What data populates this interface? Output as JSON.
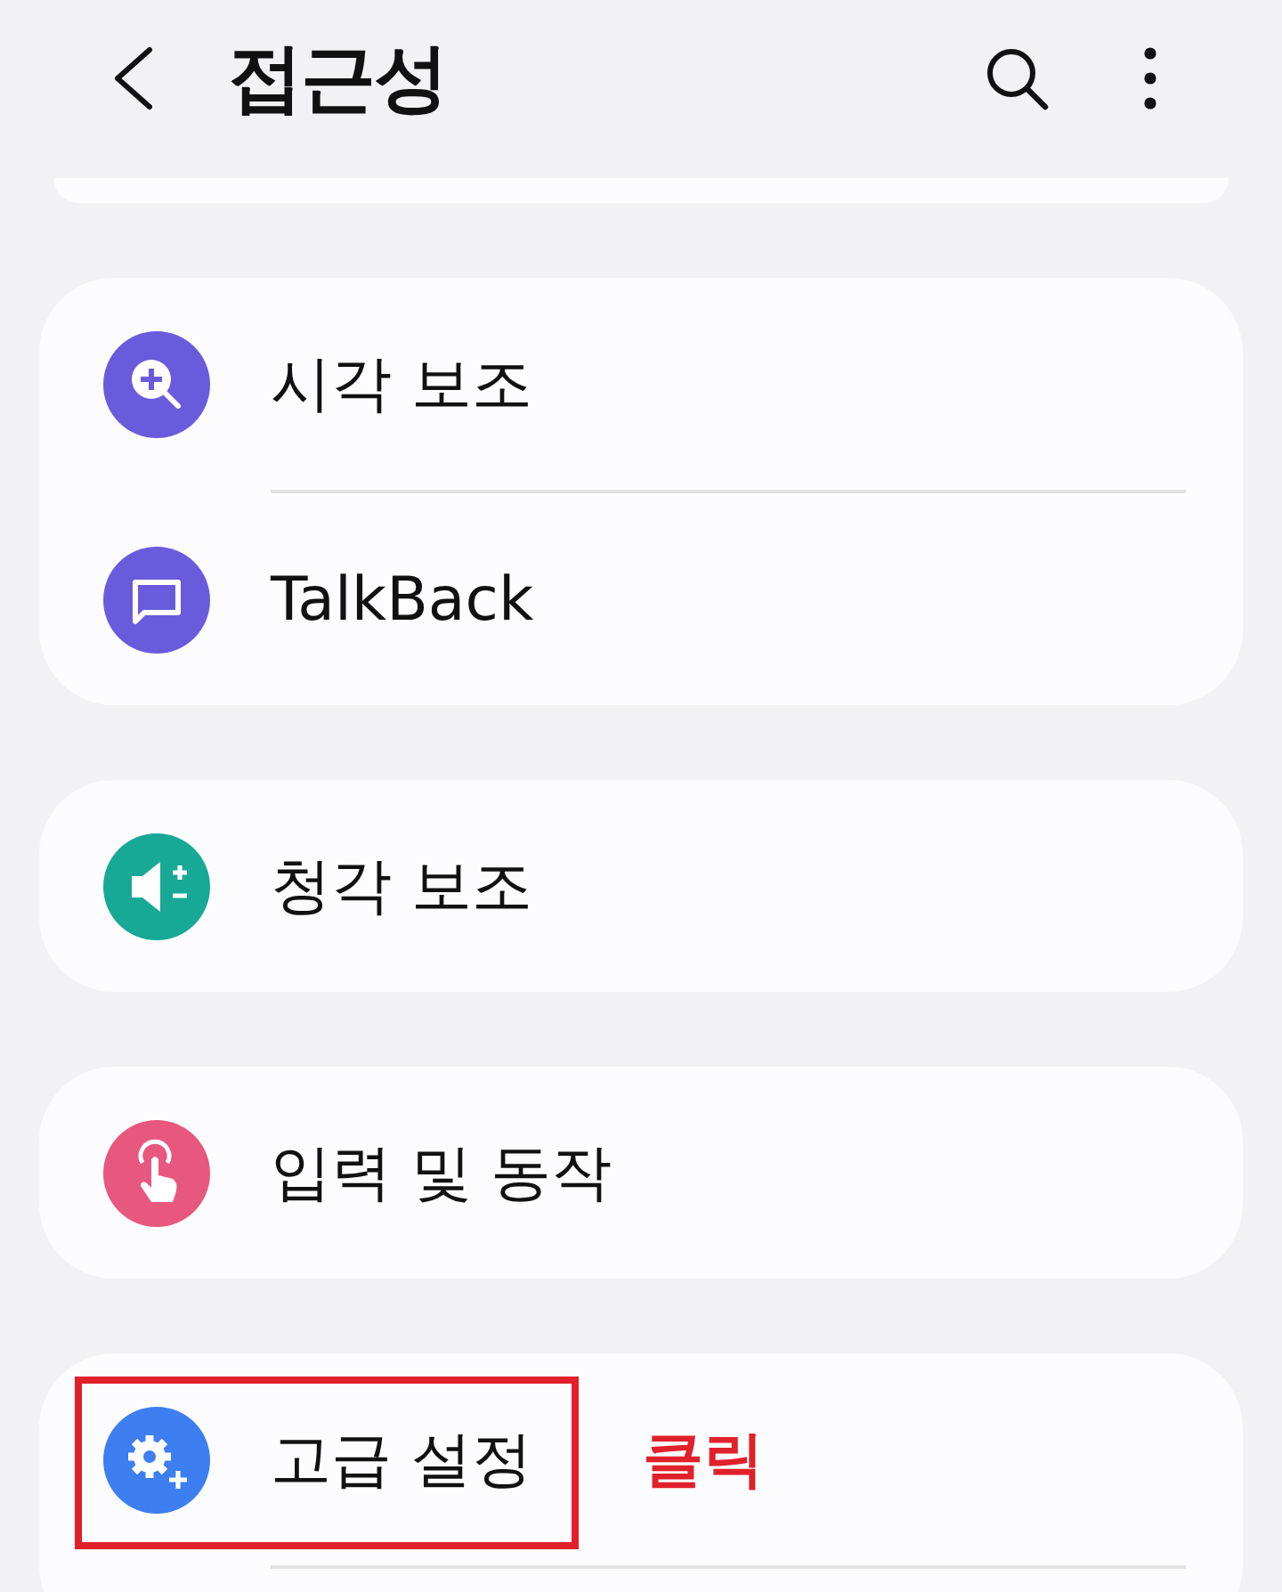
{
  "header": {
    "title": "접근성"
  },
  "groups": [
    {
      "continues": false,
      "items": [
        {
          "label": "시각 보조",
          "color": "#6a5bdc",
          "highlighted": false
        },
        {
          "label": "TalkBack",
          "color": "#6a5bdc",
          "highlighted": false
        }
      ]
    },
    {
      "continues": false,
      "items": [
        {
          "label": "청각 보조",
          "color": "#17a896",
          "highlighted": false
        }
      ]
    },
    {
      "continues": false,
      "items": [
        {
          "label": "입력 및 동작",
          "color": "#e8577f",
          "highlighted": false
        }
      ]
    },
    {
      "continues": true,
      "items": [
        {
          "label": "고급 설정",
          "color": "#3d7ef0",
          "highlighted": true
        }
      ]
    }
  ],
  "annotation": {
    "text": "클릭"
  }
}
